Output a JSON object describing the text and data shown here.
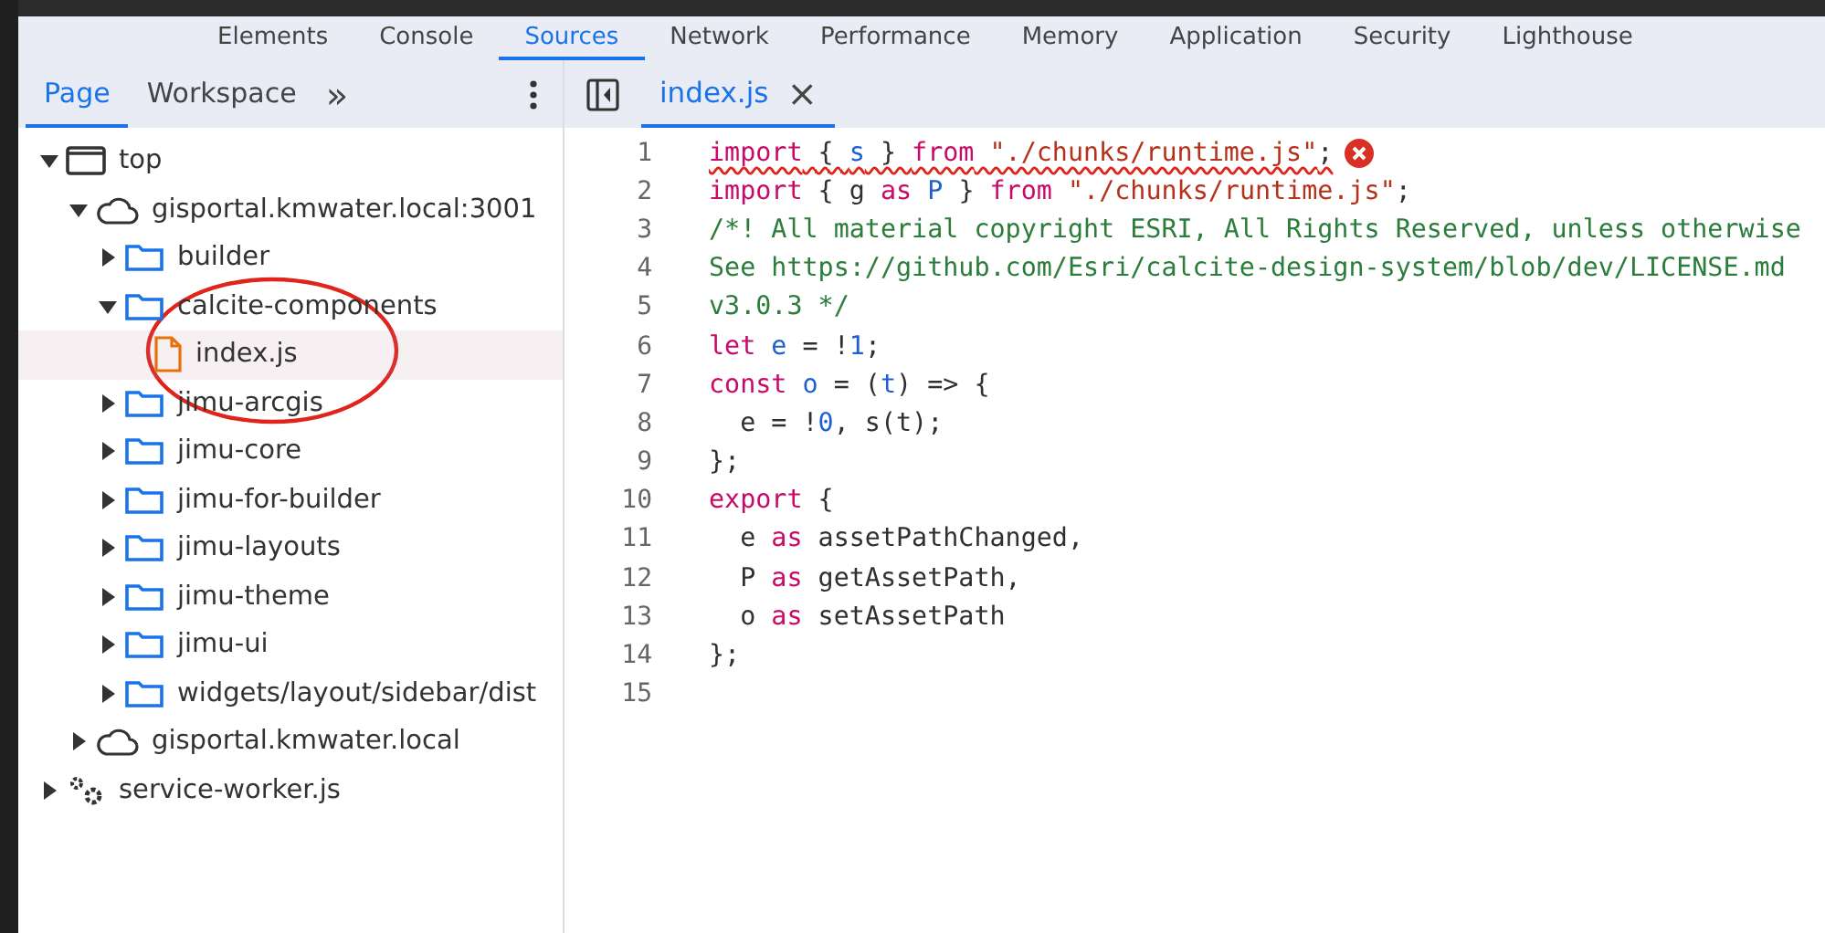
{
  "devtools_tabs": [
    {
      "label": "Elements",
      "selected": false
    },
    {
      "label": "Console",
      "selected": false
    },
    {
      "label": "Sources",
      "selected": true
    },
    {
      "label": "Network",
      "selected": false
    },
    {
      "label": "Performance",
      "selected": false
    },
    {
      "label": "Memory",
      "selected": false
    },
    {
      "label": "Application",
      "selected": false
    },
    {
      "label": "Security",
      "selected": false
    },
    {
      "label": "Lighthouse",
      "selected": false
    }
  ],
  "sidebar": {
    "tabs": [
      {
        "label": "Page",
        "selected": true
      },
      {
        "label": "Workspace",
        "selected": false
      }
    ],
    "more": "»",
    "tree": [
      {
        "kind": "frame",
        "label": "top",
        "expanded": true,
        "selected": false,
        "children": [
          {
            "kind": "origin",
            "label": "gisportal.kmwater.local:3001",
            "expanded": true,
            "selected": false,
            "children": [
              {
                "kind": "folder",
                "label": "builder",
                "expanded": false,
                "selected": false
              },
              {
                "kind": "folder",
                "label": "calcite-components",
                "expanded": true,
                "selected": false,
                "children": [
                  {
                    "kind": "file",
                    "label": "index.js",
                    "selected": true
                  }
                ]
              },
              {
                "kind": "folder",
                "label": "jimu-arcgis",
                "expanded": false,
                "selected": false
              },
              {
                "kind": "folder",
                "label": "jimu-core",
                "expanded": false,
                "selected": false
              },
              {
                "kind": "folder",
                "label": "jimu-for-builder",
                "expanded": false,
                "selected": false
              },
              {
                "kind": "folder",
                "label": "jimu-layouts",
                "expanded": false,
                "selected": false
              },
              {
                "kind": "folder",
                "label": "jimu-theme",
                "expanded": false,
                "selected": false
              },
              {
                "kind": "folder",
                "label": "jimu-ui",
                "expanded": false,
                "selected": false
              },
              {
                "kind": "folder",
                "label": "widgets/layout/sidebar/dist",
                "expanded": false,
                "selected": false
              }
            ]
          },
          {
            "kind": "origin",
            "label": "gisportal.kmwater.local",
            "expanded": false,
            "selected": false
          }
        ]
      },
      {
        "kind": "worker",
        "label": "service-worker.js",
        "expanded": false,
        "selected": false
      }
    ]
  },
  "editor": {
    "tabs": [
      {
        "label": "index.js",
        "selected": true,
        "close": "×"
      }
    ],
    "lines": [
      {
        "number": "1",
        "error": true,
        "tokens": [
          {
            "text": "import",
            "kind": "keyword"
          },
          {
            "text": " { ",
            "kind": "plain"
          },
          {
            "text": "s",
            "kind": "name"
          },
          {
            "text": " } ",
            "kind": "plain"
          },
          {
            "text": "from",
            "kind": "keyword"
          },
          {
            "text": " \"./chunks/runtime.js\"",
            "kind": "string"
          },
          {
            "text": ";",
            "kind": "plain"
          }
        ]
      },
      {
        "number": "2",
        "error": false,
        "tokens": [
          {
            "text": "import",
            "kind": "keyword"
          },
          {
            "text": " { g ",
            "kind": "plain"
          },
          {
            "text": "as",
            "kind": "keyword"
          },
          {
            "text": " P",
            "kind": "name"
          },
          {
            "text": " } ",
            "kind": "plain"
          },
          {
            "text": "from",
            "kind": "keyword"
          },
          {
            "text": " \"./chunks/runtime.js\"",
            "kind": "string"
          },
          {
            "text": ";",
            "kind": "plain"
          }
        ]
      },
      {
        "number": "3",
        "error": false,
        "tokens": [
          {
            "text": "/*! All material copyright ESRI, All Rights Reserved, unless otherwise",
            "kind": "comment"
          }
        ]
      },
      {
        "number": "4",
        "error": false,
        "tokens": [
          {
            "text": "See https://github.com/Esri/calcite-design-system/blob/dev/LICENSE.md",
            "kind": "comment"
          }
        ]
      },
      {
        "number": "5",
        "error": false,
        "tokens": [
          {
            "text": "v3.0.3 */",
            "kind": "comment"
          }
        ]
      },
      {
        "number": "6",
        "error": false,
        "tokens": [
          {
            "text": "let",
            "kind": "keyword"
          },
          {
            "text": " e",
            "kind": "name"
          },
          {
            "text": " = !",
            "kind": "plain"
          },
          {
            "text": "1",
            "kind": "number"
          },
          {
            "text": ";",
            "kind": "plain"
          }
        ]
      },
      {
        "number": "7",
        "error": false,
        "tokens": [
          {
            "text": "const",
            "kind": "keyword"
          },
          {
            "text": " o",
            "kind": "name"
          },
          {
            "text": " = (",
            "kind": "plain"
          },
          {
            "text": "t",
            "kind": "name"
          },
          {
            "text": ") => {",
            "kind": "plain"
          }
        ]
      },
      {
        "number": "8",
        "error": false,
        "tokens": [
          {
            "text": "  e = !",
            "kind": "plain"
          },
          {
            "text": "0",
            "kind": "number"
          },
          {
            "text": ", s(t);",
            "kind": "plain"
          }
        ]
      },
      {
        "number": "9",
        "error": false,
        "tokens": [
          {
            "text": "};",
            "kind": "plain"
          }
        ]
      },
      {
        "number": "10",
        "error": false,
        "tokens": [
          {
            "text": "export",
            "kind": "keyword"
          },
          {
            "text": " {",
            "kind": "plain"
          }
        ]
      },
      {
        "number": "11",
        "error": false,
        "tokens": [
          {
            "text": "  e ",
            "kind": "plain"
          },
          {
            "text": "as",
            "kind": "keyword"
          },
          {
            "text": " assetPathChanged,",
            "kind": "plain"
          }
        ]
      },
      {
        "number": "12",
        "error": false,
        "tokens": [
          {
            "text": "  P ",
            "kind": "plain"
          },
          {
            "text": "as",
            "kind": "keyword"
          },
          {
            "text": " getAssetPath,",
            "kind": "plain"
          }
        ]
      },
      {
        "number": "13",
        "error": false,
        "tokens": [
          {
            "text": "  o ",
            "kind": "plain"
          },
          {
            "text": "as",
            "kind": "keyword"
          },
          {
            "text": " setAssetPath",
            "kind": "plain"
          }
        ]
      },
      {
        "number": "14",
        "error": false,
        "tokens": [
          {
            "text": "};",
            "kind": "plain"
          }
        ]
      },
      {
        "number": "15",
        "error": false
      }
    ]
  }
}
